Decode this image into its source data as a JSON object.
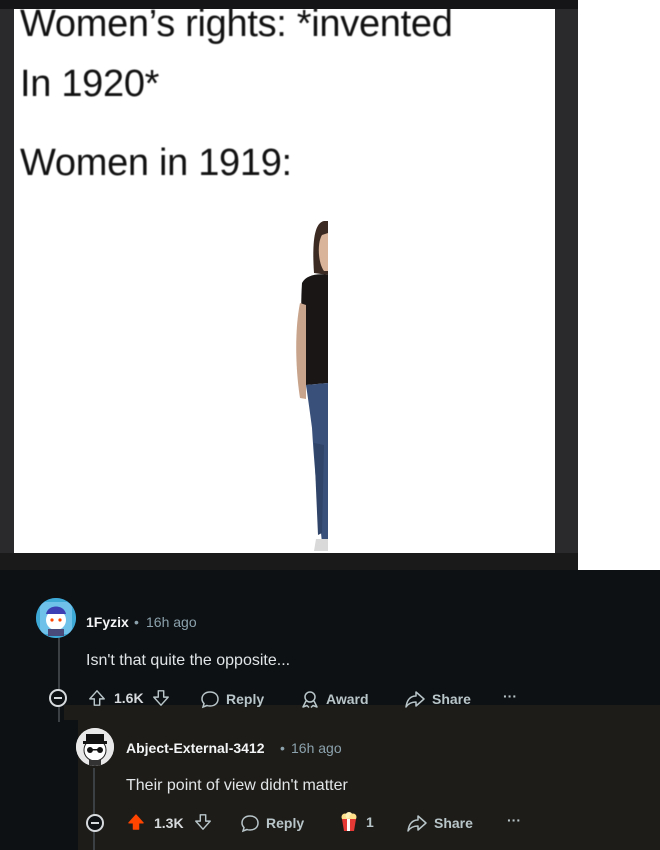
{
  "meme": {
    "line1": "Women’s rights: *invented",
    "line2": "In 1920*",
    "line3": "Women in 1919:"
  },
  "comments": [
    {
      "username": "1Fyzix",
      "separator": "•",
      "time": "16h ago",
      "body": "Isn't that quite the opposite...",
      "score": "1.6K",
      "reply_label": "Reply",
      "award_label": "Award",
      "share_label": "Share",
      "more_label": "···"
    },
    {
      "username": "Abject-External-3412",
      "separator": "•",
      "time": "16h ago",
      "body": "Their point of view didn't matter",
      "score": "1.3K",
      "reply_label": "Reply",
      "award_count": "1",
      "share_label": "Share",
      "more_label": "···"
    }
  ],
  "colors": {
    "background": "#0e1113",
    "upvote_active": "#ff4500",
    "text_muted": "#b8c5c9"
  }
}
